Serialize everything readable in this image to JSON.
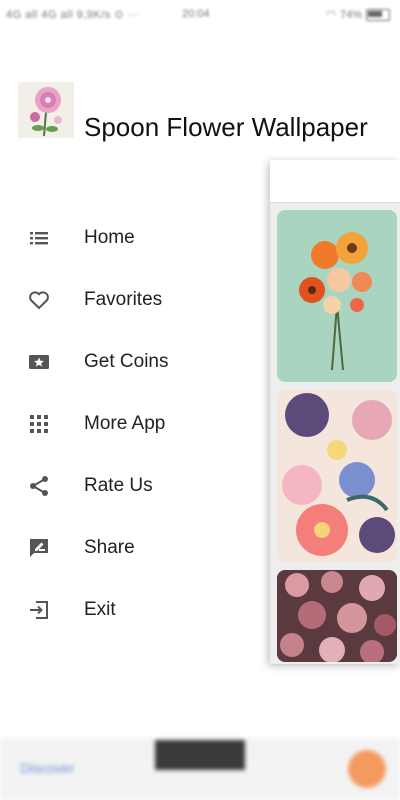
{
  "status_bar": {
    "left": "4G all 4G all 9,9K/s ⊙ ···",
    "time": "20:04",
    "battery": "74%"
  },
  "drawer": {
    "app_title": "Spoon Flower Wallpaper",
    "items": [
      {
        "label": "Home",
        "icon": "list-icon"
      },
      {
        "label": "Favorites",
        "icon": "heart-icon"
      },
      {
        "label": "Get Coins",
        "icon": "star-ticket-icon"
      },
      {
        "label": "More App",
        "icon": "grid-icon"
      },
      {
        "label": "Rate Us",
        "icon": "share-network-icon"
      },
      {
        "label": "Share",
        "icon": "feedback-icon"
      },
      {
        "label": "Exit",
        "icon": "exit-icon"
      }
    ]
  },
  "ad": {
    "left_text": "Discover",
    "mid_text": ""
  },
  "colors": {
    "accent": "#222222",
    "icon": "#555555",
    "tile1_bg": "#a9d4c0",
    "tile3_bg": "#5a3a3f"
  }
}
